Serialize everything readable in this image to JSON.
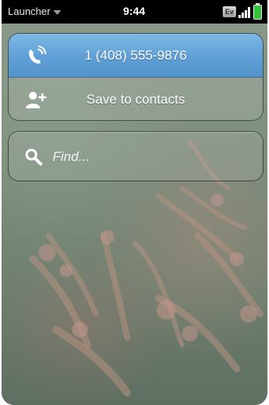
{
  "status_bar": {
    "launcher_label": "Launcher",
    "time": "9:44",
    "network": "Ev"
  },
  "actions": [
    {
      "label": "1 (408) 555-9876",
      "icon": "phone-call-icon",
      "selected": true
    },
    {
      "label": "Save to contacts",
      "icon": "add-contact-icon",
      "selected": false
    }
  ],
  "search": {
    "placeholder": "Find...",
    "value": ""
  },
  "colors": {
    "selection_blue": "#6aa7dc",
    "battery_green": "#36c23a",
    "statusbar_bg": "#000000"
  }
}
